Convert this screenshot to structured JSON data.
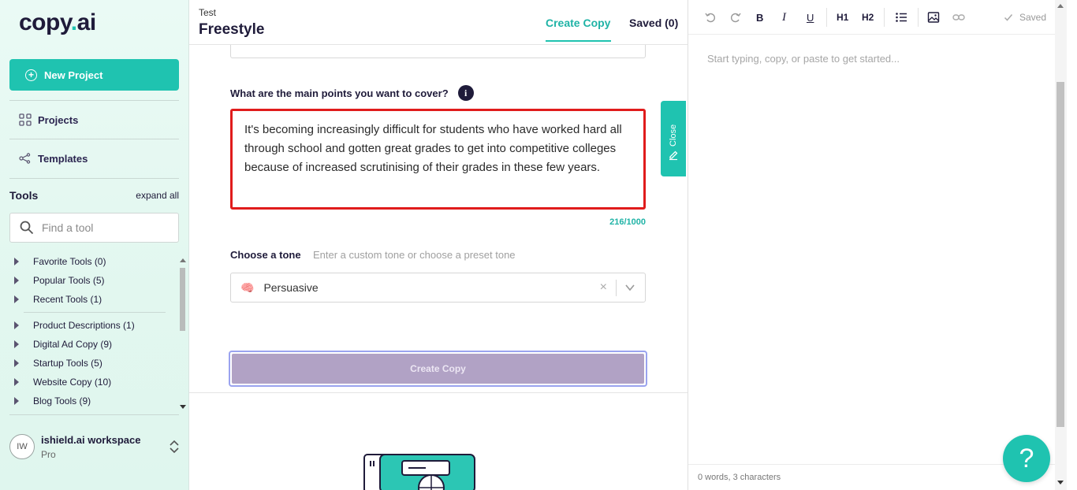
{
  "sidebar": {
    "logo": {
      "text": "copy",
      "dot": ".",
      "suffix": "ai"
    },
    "new_project_label": "New Project",
    "nav": [
      {
        "label": "Projects",
        "icon": "grid-icon"
      },
      {
        "label": "Templates",
        "icon": "share-nodes-icon"
      }
    ],
    "tools_title": "Tools",
    "expand_all": "expand all",
    "search_placeholder": "Find a tool",
    "tool_groups_top": [
      "Favorite Tools (0)",
      "Popular Tools (5)",
      "Recent Tools (1)"
    ],
    "tool_groups": [
      "Product Descriptions (1)",
      "Digital Ad Copy (9)",
      "Startup Tools (5)",
      "Website Copy (10)",
      "Blog Tools (9)"
    ],
    "workspace": {
      "initials": "IW",
      "name": "ishield.ai workspace",
      "plan": "Pro"
    }
  },
  "header": {
    "breadcrumb": "Test",
    "title": "Freestyle",
    "tabs": {
      "create": "Create Copy",
      "saved": "Saved (0)"
    }
  },
  "form": {
    "points_label": "What are the main points you want to cover?",
    "info_icon": "i",
    "points_text": "It's becoming increasingly difficult for students who have worked hard all through school and gotten great grades to get into competitive colleges because of increased scrutinising of their grades in these few years.",
    "counter": "216/1000",
    "tone_label": "Choose a tone",
    "tone_hint": "Enter a custom tone or choose a preset tone",
    "tone_emoji": "🧠",
    "tone_value": "Persuasive",
    "tone_clear": "×",
    "create_button": "Create Copy",
    "close_tab": "Close"
  },
  "editor": {
    "toolbar": {
      "bold": "B",
      "italic": "I",
      "underline": "U",
      "h1": "H1",
      "h2": "H2",
      "saved": "Saved"
    },
    "placeholder": "Start typing, copy, or paste to get started...",
    "word_count": "0 words, 3 characters",
    "help": "?"
  },
  "colors": {
    "accent": "#1fc3b0",
    "primary_text": "#1f1b3a",
    "highlight_border": "#e01c1c",
    "button_disabled": "#b1a2c5"
  }
}
